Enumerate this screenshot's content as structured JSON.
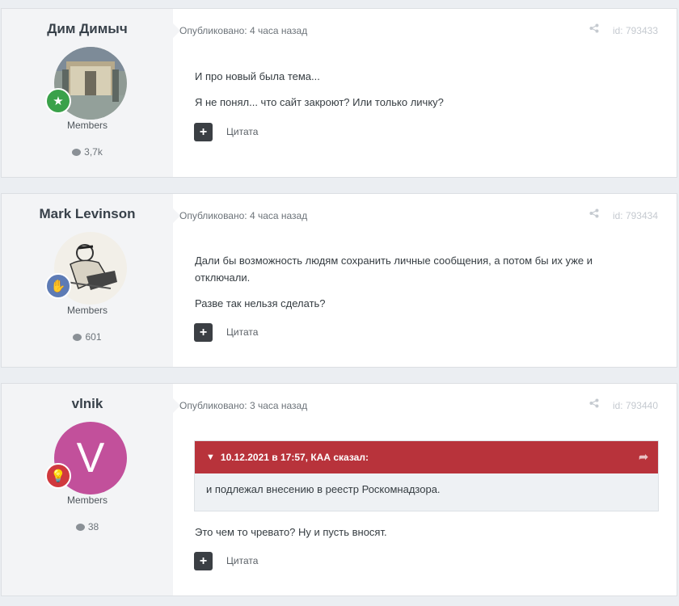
{
  "posts": [
    {
      "author": "Дим Димыч",
      "group": "Members",
      "count": "3,7k",
      "published": "Опубликовано: 4 часа назад",
      "id": "id: 793433",
      "paragraphs": [
        "И про новый была тема...",
        "Я не понял... что сайт закроют? Или только личку?"
      ],
      "quote_link": "Цитата",
      "badge_icon": "star-icon",
      "badge_color": "#3aa14a"
    },
    {
      "author": "Mark Levinson",
      "group": "Members",
      "count": "601",
      "published": "Опубликовано: 4 часа назад",
      "id": "id: 793434",
      "paragraphs": [
        "Дали бы возможность людям сохранить личные сообщения, а потом бы их уже и отключали.",
        "Разве так нельзя сделать?"
      ],
      "quote_link": "Цитата",
      "badge_icon": "hand-icon",
      "badge_color": "#5d7bb5"
    },
    {
      "author": "vlnik",
      "group": "Members",
      "count": "38",
      "published": "Опубликовано: 3 часа назад",
      "id": "id: 793440",
      "avatar_letter": "V",
      "avatar_color": "#c2509b",
      "quote": {
        "header": "10.12.2021 в 17:57, КАА сказал:",
        "text": "и подлежал внесению в реестр Роскомнадзора."
      },
      "paragraphs": [
        "Это чем то чревато? Ну и пусть вносят."
      ],
      "quote_link": "Цитата",
      "badge_icon": "lightbulb-icon",
      "badge_color": "#d0393e"
    }
  ]
}
